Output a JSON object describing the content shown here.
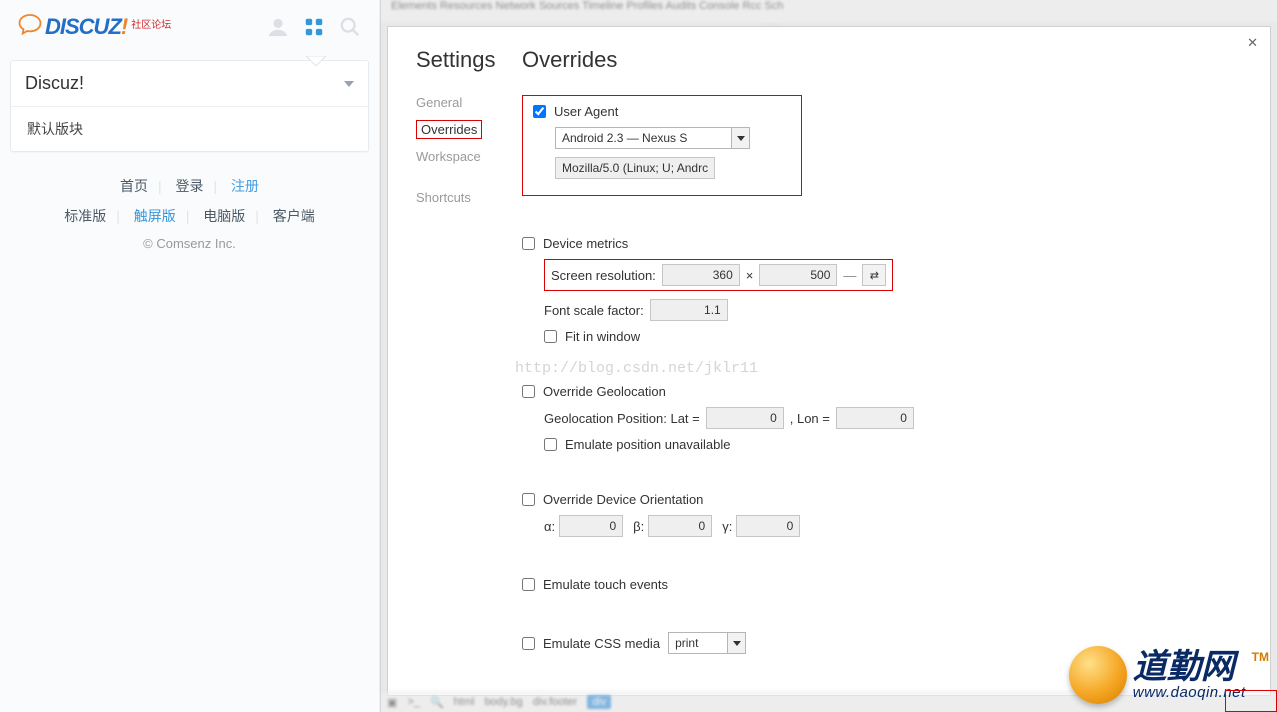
{
  "logo": {
    "text": "DISCUZ",
    "bang": "!",
    "subtitle": "社区论坛"
  },
  "dropdown": {
    "title": "Discuz!"
  },
  "board": "默认版块",
  "footerLine1": {
    "home": "首页",
    "login": "登录",
    "register": "注册"
  },
  "footerLine2": {
    "std": "标准版",
    "touch": "触屏版",
    "pc": "电脑版",
    "client": "客户端"
  },
  "copyright": "© Comsenz Inc.",
  "tabbar": "Elements   Resources   Network   Sources   Timeline   Profiles   Audits   Console   Rcc   Sch",
  "settings": {
    "title": "Settings",
    "nav": {
      "general": "General",
      "overrides": "Overrides",
      "workspace": "Workspace",
      "shortcuts": "Shortcuts"
    },
    "pageTitle": "Overrides",
    "ua": {
      "label": "User Agent",
      "option": "Android 2.3 — Nexus S",
      "string": "Mozilla/5.0 (Linux; U; Andrc"
    },
    "dm": {
      "label": "Device metrics",
      "resLabel": "Screen resolution:",
      "w": "360",
      "h": "500",
      "fontLabel": "Font scale factor:",
      "font": "1.1",
      "fit": "Fit in window"
    },
    "geo": {
      "label": "Override Geolocation",
      "posLabel": "Geolocation Position: Lat =",
      "lat": "0",
      "lonLabel": ", Lon =",
      "lon": "0",
      "emu": "Emulate position unavailable"
    },
    "orient": {
      "label": "Override Device Orientation",
      "a": "α:",
      "av": "0",
      "b": "β:",
      "bv": "0",
      "g": "γ:",
      "gv": "0"
    },
    "touch": "Emulate touch events",
    "css": {
      "label": "Emulate CSS media",
      "value": "print"
    }
  },
  "watermark": "http://blog.csdn.net/jklr11",
  "bottom": {
    "body": "body.bg",
    "div": "div.footer",
    "pill": "div"
  },
  "daoqin": {
    "big": "道勤网",
    "url": "www.daoqin.net",
    "tm": "TM"
  }
}
